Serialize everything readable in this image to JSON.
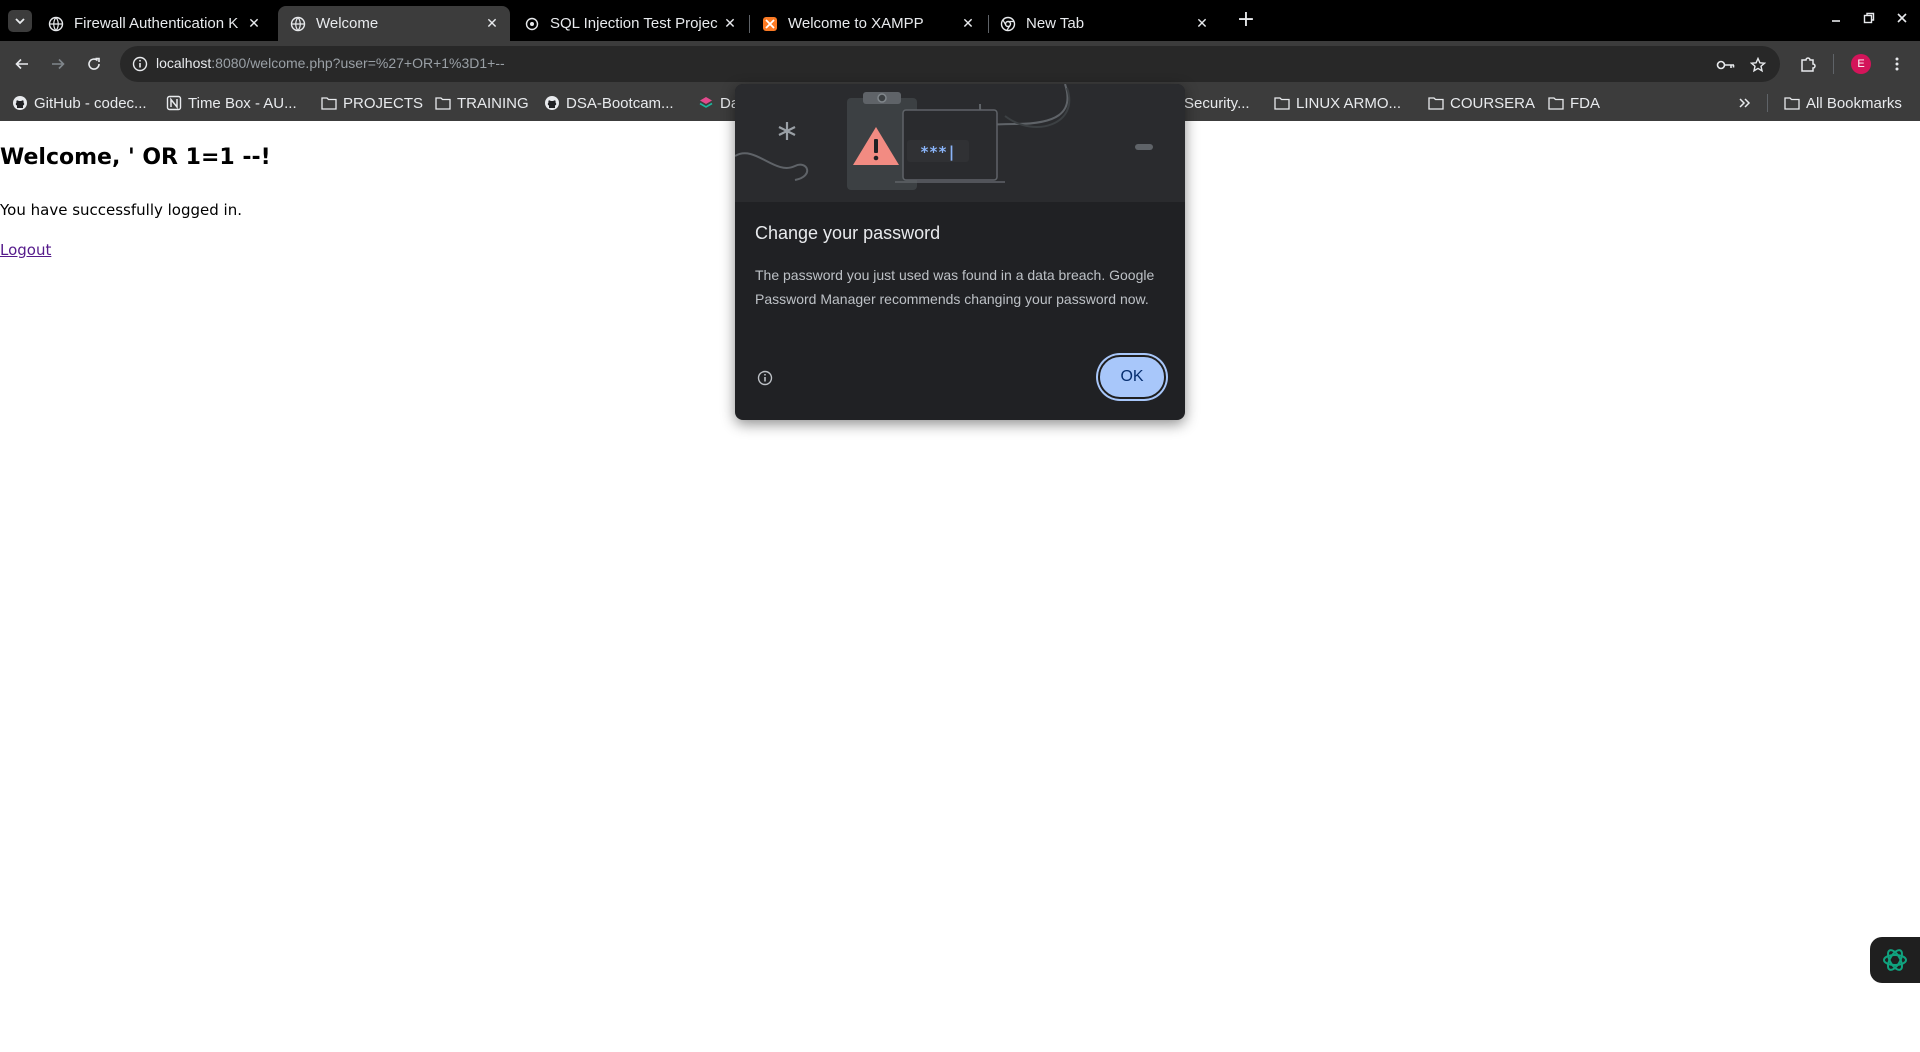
{
  "tabs": [
    {
      "title": "Firewall Authentication K",
      "favicon": "globe-icon",
      "active": false
    },
    {
      "title": "Welcome",
      "favicon": "globe-icon",
      "active": true
    },
    {
      "title": "SQL Injection Test Projec",
      "favicon": "openai-icon",
      "active": false
    },
    {
      "title": "Welcome to XAMPP",
      "favicon": "xampp-icon",
      "active": false
    },
    {
      "title": "New Tab",
      "favicon": "chrome-icon",
      "active": false
    }
  ],
  "toolbar": {
    "url_host": "localhost",
    "url_rest": ":8080/welcome.php?user=%27+OR+1%3D1+--",
    "profile_initial": "E"
  },
  "bookmarks": [
    {
      "label": "GitHub - codec...",
      "icon": "github-icon"
    },
    {
      "label": "Time Box - AU...",
      "icon": "notion-icon"
    },
    {
      "label": "PROJECTS",
      "icon": "folder-icon"
    },
    {
      "label": "TRAINING",
      "icon": "folder-icon"
    },
    {
      "label": "DSA-Bootcam...",
      "icon": "github-icon"
    },
    {
      "label": "Da",
      "icon": "layers-icon"
    },
    {
      "label": "Security...",
      "icon": "folder-icon"
    },
    {
      "label": "LINUX ARMO...",
      "icon": "folder-icon"
    },
    {
      "label": "COURSERA",
      "icon": "folder-icon"
    },
    {
      "label": "FDA",
      "icon": "folder-icon"
    }
  ],
  "all_bookmarks_label": "All Bookmarks",
  "page": {
    "heading": "Welcome, ' OR 1=1 --!",
    "message": "You have successfully logged in.",
    "logout_label": "Logout"
  },
  "dialog": {
    "title": "Change your password",
    "body": "The password you just used was found in a data breach. Google Password Manager recommends changing your password now.",
    "illustration_text": "***|",
    "ok_label": "OK"
  },
  "colors": {
    "dialog_bg": "#202124",
    "ok_button": "#a8c7fa",
    "link_visited": "#551a8b",
    "warning": "#f28b82"
  }
}
